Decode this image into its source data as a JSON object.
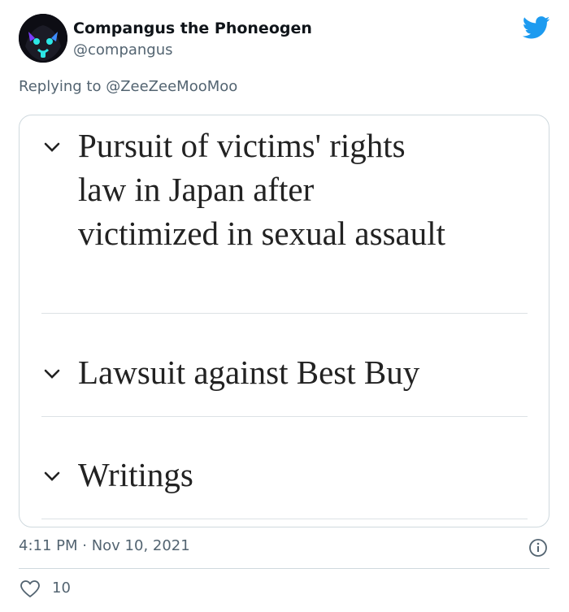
{
  "tweet": {
    "display_name": "Compangus the Phoneogen",
    "handle": "@compangus",
    "replying_prefix": "Replying to ",
    "replying_to": "@ZeeZeeMooMoo",
    "timestamp": "4:11 PM · Nov 10, 2021",
    "like_count": "10"
  },
  "card": {
    "sections": [
      {
        "title": "Pursuit of victims' rights law in Japan after victimized in sexual assault"
      },
      {
        "title": "Lawsuit against Best Buy"
      },
      {
        "title": "Writings"
      }
    ]
  },
  "icons": {
    "brand": "twitter-bird-icon",
    "chevron": "chevron-down-icon",
    "info": "info-icon",
    "like": "heart-icon"
  },
  "colors": {
    "twitter_blue": "#1d9bf0",
    "secondary_text": "#536471",
    "border": "#cfd9de"
  }
}
